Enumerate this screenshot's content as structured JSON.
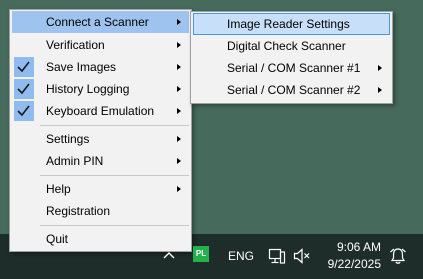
{
  "main_menu": {
    "items": [
      {
        "label": "Connect a Scanner"
      },
      {
        "label": "Verification"
      },
      {
        "label": "Save Images"
      },
      {
        "label": "History Logging"
      },
      {
        "label": "Keyboard Emulation"
      },
      {
        "label": "Settings"
      },
      {
        "label": "Admin PIN"
      },
      {
        "label": "Help"
      },
      {
        "label": "Registration"
      },
      {
        "label": "Quit"
      }
    ]
  },
  "sub_menu": {
    "items": [
      {
        "label": "Image Reader Settings"
      },
      {
        "label": "Digital Check Scanner"
      },
      {
        "label": "Serial / COM Scanner #1"
      },
      {
        "label": "Serial / COM Scanner #2"
      }
    ]
  },
  "taskbar": {
    "app_badge": "PL",
    "language": "ENG",
    "time": "9:06 AM",
    "date": "9/22/2025"
  },
  "colors": {
    "desktop": "#466a5b",
    "highlight": "#9ec3ef",
    "check_bg": "#8fbbef"
  }
}
